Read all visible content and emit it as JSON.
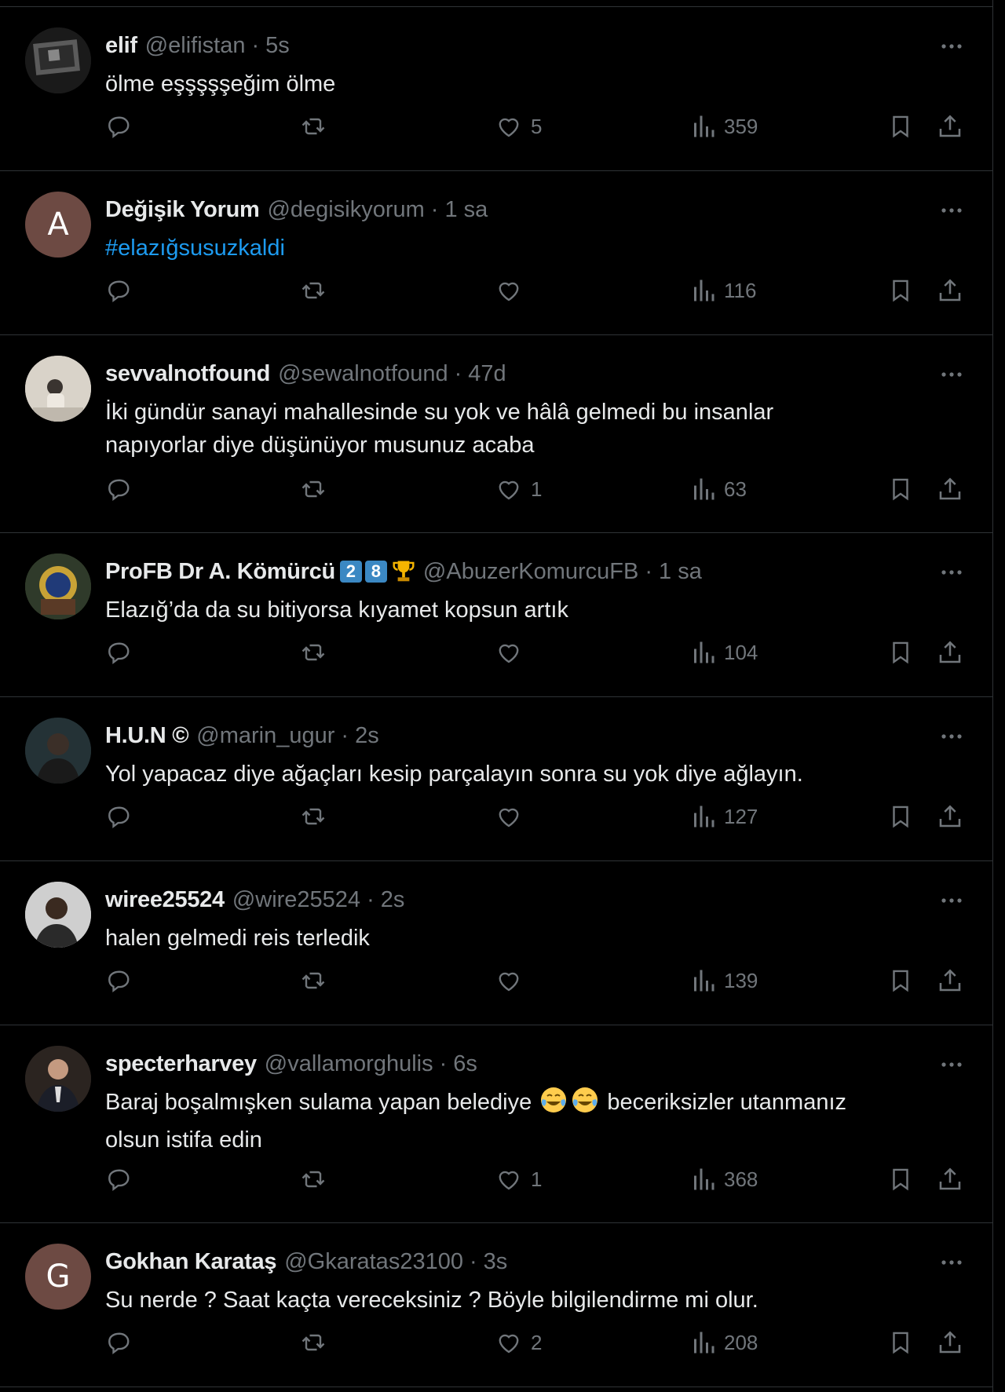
{
  "tweets": [
    {
      "name": "elif",
      "handle": "@elifistan",
      "time": "5s",
      "text": "ölme eşşşşşeğim ölme",
      "replies": "",
      "retweets": "",
      "likes": "5",
      "views": "359"
    },
    {
      "name": "Değişik Yorum",
      "handle": "@degisikyorum",
      "time": "1 sa",
      "text": "#elazığsusuzkaldi",
      "avatar_letter": "A",
      "replies": "",
      "retweets": "",
      "likes": "",
      "views": "116"
    },
    {
      "name": "sevvalnotfound",
      "handle": "@sewalnotfound",
      "time": "47d",
      "text_lines": [
        "İki gündür sanayi mahallesinde su yok ve hâlâ gelmedi bu insanlar",
        "napıyorlar diye düşünüyor musunuz acaba"
      ],
      "replies": "",
      "retweets": "",
      "likes": "1",
      "views": "63"
    },
    {
      "name": "ProFB Dr A. Kömürcü",
      "badges": [
        "2",
        "8"
      ],
      "handle": "@AbuzerKomurcuFB",
      "time": "1 sa",
      "text": "Elazığ’da da su bitiyorsa kıyamet kopsun artık",
      "replies": "",
      "retweets": "",
      "likes": "",
      "views": "104"
    },
    {
      "name": "H.U.N ©",
      "handle": "@marin_ugur",
      "time": "2s",
      "text": "Yol yapacaz diye ağaçları kesip parçalayın sonra su yok diye ağlayın.",
      "replies": "",
      "retweets": "",
      "likes": "",
      "views": "127"
    },
    {
      "name": "wiree25524",
      "handle": "@wire25524",
      "time": "2s",
      "text": "halen gelmedi reis terledik",
      "replies": "",
      "retweets": "",
      "likes": "",
      "views": "139"
    },
    {
      "name": "specterharvey",
      "handle": "@vallamorghulis",
      "time": "6s",
      "text_a": "Baraj boşalmışken sulama yapan belediye",
      "text_b": "beceriksizler utanmanız",
      "text_c": "olsun istifa edin",
      "replies": "",
      "retweets": "",
      "likes": "1",
      "views": "368"
    },
    {
      "name": "Gokhan Karataş",
      "handle": "@Gkaratas23100",
      "time": "3s",
      "text": "Su nerde ? Saat kaçta vereceksiniz ? Böyle bilgilendirme mi olur.",
      "avatar_letter": "G",
      "replies": "",
      "retweets": "",
      "likes": "2",
      "views": "208"
    }
  ],
  "colors": {
    "background": "#000000",
    "text": "#e7e9ea",
    "secondary": "#71767b",
    "link": "#1d9bf0",
    "divider": "#2f3336"
  },
  "icons": {
    "reply": "reply-icon",
    "retweet": "retweet-icon",
    "like": "heart-icon",
    "views": "views-icon",
    "bookmark": "bookmark-icon",
    "share": "share-icon",
    "more": "more-icon"
  }
}
